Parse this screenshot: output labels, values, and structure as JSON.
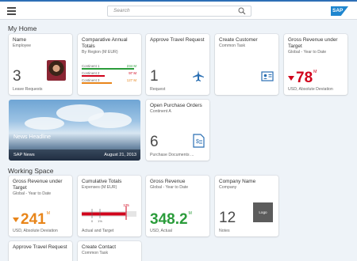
{
  "shell": {
    "search_placeholder": "Search",
    "logo": "SAP"
  },
  "groups": {
    "my_home": "My Home",
    "working_space": "Working Space"
  },
  "tiles": {
    "employee": {
      "title": "Name",
      "subtitle": "Employee",
      "value": "3",
      "footer": "Leave Requests",
      "avatar_icon": "person-photo"
    },
    "comparative": {
      "title": "Comparative Annual Totals",
      "subtitle": "By Region (M EUR)",
      "rows": [
        {
          "label": "Continent 1",
          "value": "234 M",
          "fraction": 0.95,
          "color": "#2b9c3b"
        },
        {
          "label": "Continent 2",
          "value": "97 M",
          "fraction": 0.42,
          "color": "#d0021b"
        },
        {
          "label": "Continent 3",
          "value": "127 M",
          "fraction": 0.55,
          "color": "#e8851a"
        }
      ]
    },
    "travel": {
      "title": "Approve Travel Request",
      "value": "1",
      "footer": "Request",
      "icon": "airplane-icon"
    },
    "customer": {
      "title": "Create Customer",
      "subtitle": "Common Task",
      "icon": "customer-card-icon"
    },
    "revenue_home": {
      "title": "Gross Revenue under Target",
      "subtitle": "Global - Year to Date",
      "value": "78",
      "unit": "M",
      "footer": "USD, Absolute Deviation",
      "trend": "down",
      "color": "#d0021b"
    },
    "news": {
      "headline": "News Headline",
      "source": "SAP News",
      "date": "August 21, 2013"
    },
    "purchase": {
      "title": "Open Purchase Orders",
      "subtitle": "Continent A",
      "value": "6",
      "footer": "Purchase Documents ...",
      "icon": "purchase-document-icon"
    },
    "revenue_ws": {
      "title": "Gross Revenue under Target",
      "subtitle": "Global - Year to Date",
      "value": "241",
      "unit": "M",
      "footer": "USD, Absolute Deviation",
      "trend": "down",
      "color": "#e8851a"
    },
    "cumulative": {
      "title": "Cumulative Totals",
      "subtitle": "Expenses (M EUR)",
      "footer": "Actual and Target",
      "chart": {
        "actual": 125,
        "target_label": "125",
        "scale_labels": [
          "0",
          "1%"
        ],
        "fraction": 0.8
      }
    },
    "gross": {
      "title": "Gross Revenue",
      "subtitle": "Global - Year to Date",
      "value": "348.2",
      "unit": "M",
      "footer": "USD, Actual",
      "color": "#2b9c3b"
    },
    "company": {
      "title": "Company Name",
      "subtitle": "Company",
      "value": "12",
      "footer": "Notes",
      "logo_label": "Logo"
    },
    "travel2": {
      "title": "Approve Travel Request"
    },
    "contact": {
      "title": "Create Contact",
      "subtitle": "Common Task"
    }
  }
}
